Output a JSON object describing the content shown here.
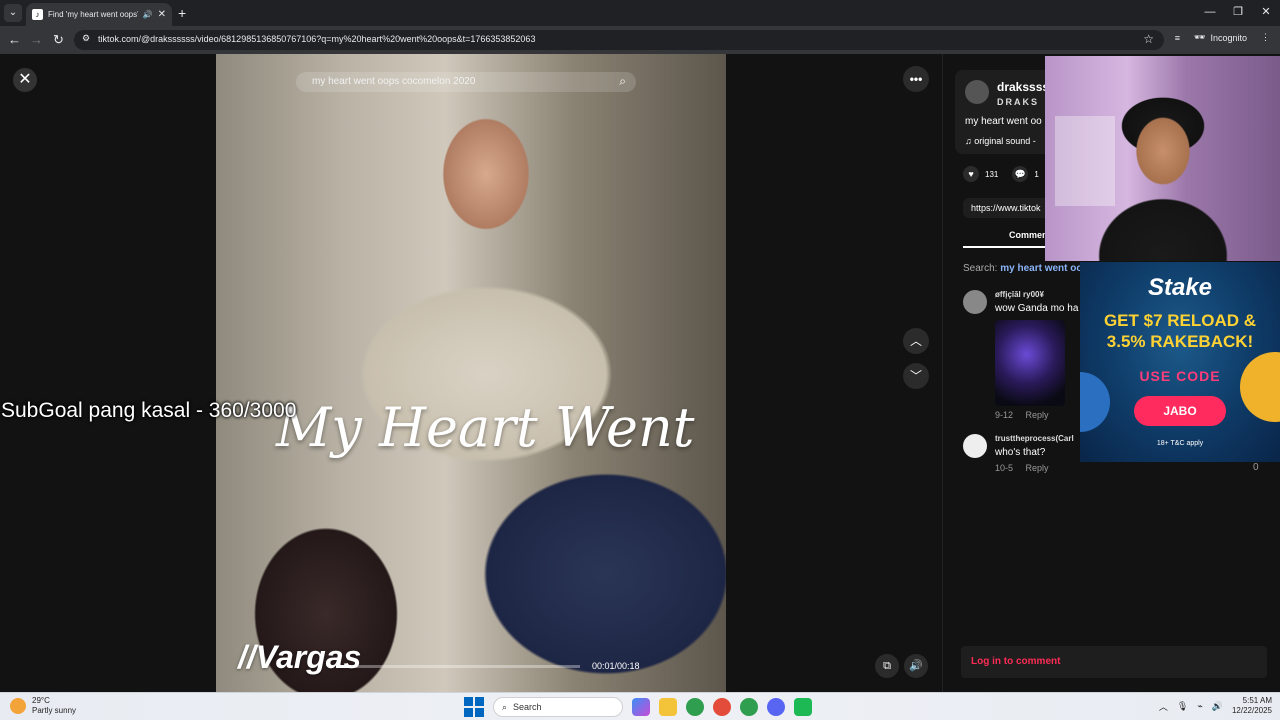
{
  "browser": {
    "tab_title": "Find 'my heart went oops' c",
    "tab_favicon": "tiktok-favicon",
    "url": "tiktok.com/@drakssssss/video/6812985136850767106?q=my%20heart%20went%20oops&t=1766353852063",
    "incognito_label": "Incognito"
  },
  "video": {
    "search_text": "my heart went oops cocomelon 2020",
    "overlay_title": "My Heart Went",
    "watermark": "//Vargas",
    "time": "00:01/00:18",
    "progress": 0.06
  },
  "stream_overlay": {
    "subgoal": "SubGoal pang kasal - 360/3000"
  },
  "panel": {
    "author_handle": "drakssss",
    "author_name": "DRAKS",
    "description": "my heart went oo",
    "music": "original sound - ",
    "likes": "131",
    "comments": "1",
    "link": "https://www.tiktok",
    "tab_comments": "Commen",
    "search_label": "Search:",
    "search_query": "my heart went oo",
    "comment_list": [
      {
        "user": "øffįçîāl ry00¥",
        "text": "wow Ganda mo ha",
        "date": "9-12",
        "reply": "Reply"
      },
      {
        "user": "trusttheprocess(Carl",
        "text": "who's that?",
        "date": "10-5",
        "reply": "Reply"
      }
    ],
    "like_count_zero": "0",
    "login": "Log in to comment"
  },
  "ad": {
    "brand": "Stake",
    "offer_line1": "GET $7 RELOAD &",
    "offer_line2": "3.5% RAKEBACK!",
    "code_label": "USE CODE",
    "code": "JABO",
    "legal": "18+ T&C apply"
  },
  "taskbar": {
    "temp": "29°C",
    "weather": "Partly sunny",
    "search": "Search",
    "time": "5:51 AM",
    "date": "12/22/2025"
  },
  "colors": {
    "tiktok_red": "#fe2c55",
    "stake_pink": "#ff2b5e",
    "stake_yellow": "#ffd233"
  }
}
